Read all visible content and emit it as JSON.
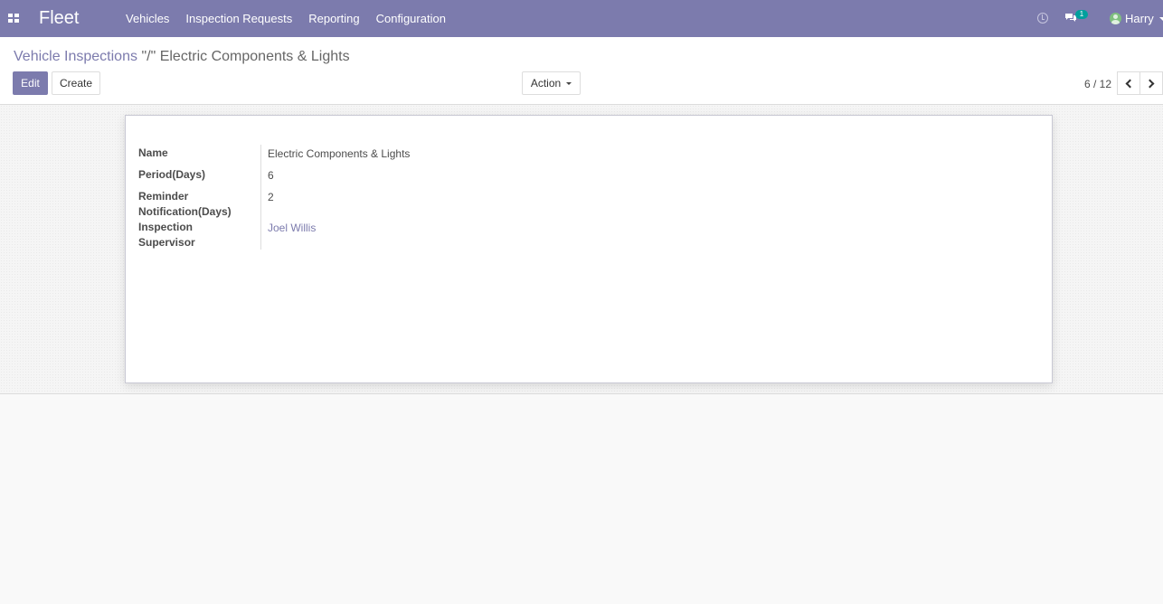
{
  "navbar": {
    "brand": "Fleet",
    "menu": [
      "Vehicles",
      "Inspection Requests",
      "Reporting",
      "Configuration"
    ],
    "chat_count": "1",
    "user": "Harry",
    "bg_color": "#7c7bad"
  },
  "breadcrumb": {
    "parent": "Vehicle Inspections",
    "current": "\"/\" Electric Components & Lights"
  },
  "buttons": {
    "edit": "Edit",
    "create": "Create",
    "action": "Action"
  },
  "pager": {
    "value": "6 / 12"
  },
  "form": {
    "fields": [
      {
        "label": "Name",
        "value": "Electric Components & Lights"
      },
      {
        "label": "Period(Days)",
        "value": "6"
      },
      {
        "label": "Reminder Notification(Days)",
        "value": "2"
      },
      {
        "label": "Inspection Supervisor",
        "value": "Joel Willis"
      }
    ]
  }
}
